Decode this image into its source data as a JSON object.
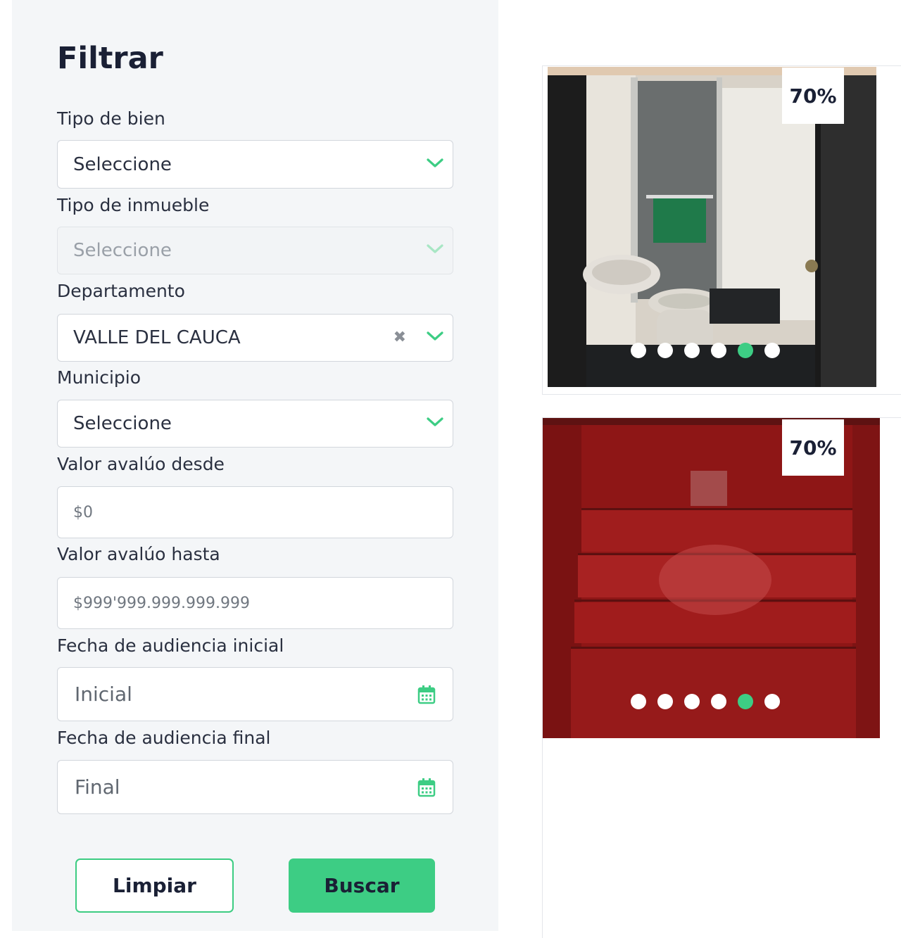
{
  "filter": {
    "title": "Filtrar",
    "tipo_bien": {
      "label": "Tipo de bien",
      "value": "Seleccione"
    },
    "tipo_inmueble": {
      "label": "Tipo de inmueble",
      "value": "Seleccione"
    },
    "departamento": {
      "label": "Departamento",
      "value": "VALLE DEL CAUCA"
    },
    "municipio": {
      "label": "Municipio",
      "value": "Seleccione"
    },
    "valor_desde": {
      "label": "Valor avalúo desde",
      "placeholder": "$0"
    },
    "valor_hasta": {
      "label": "Valor avalúo hasta",
      "placeholder": "$999'999.999.999.999"
    },
    "fecha_inicial": {
      "label": "Fecha de audiencia inicial",
      "placeholder": "Inicial"
    },
    "fecha_final": {
      "label": "Fecha de audiencia final",
      "placeholder": "Final"
    },
    "clear_label": "Limpiar",
    "search_label": "Buscar"
  },
  "cards": [
    {
      "discount": "70%",
      "dots_total": 6,
      "active_dot": 5
    },
    {
      "discount": "70%",
      "dots_total": 6,
      "active_dot": 5
    }
  ],
  "colors": {
    "accent": "#3dcd84",
    "text_dark": "#1a2035",
    "sidebar_bg": "#f4f6f8"
  },
  "icons": [
    "chevron-down-icon",
    "clear-icon",
    "calendar-icon"
  ]
}
